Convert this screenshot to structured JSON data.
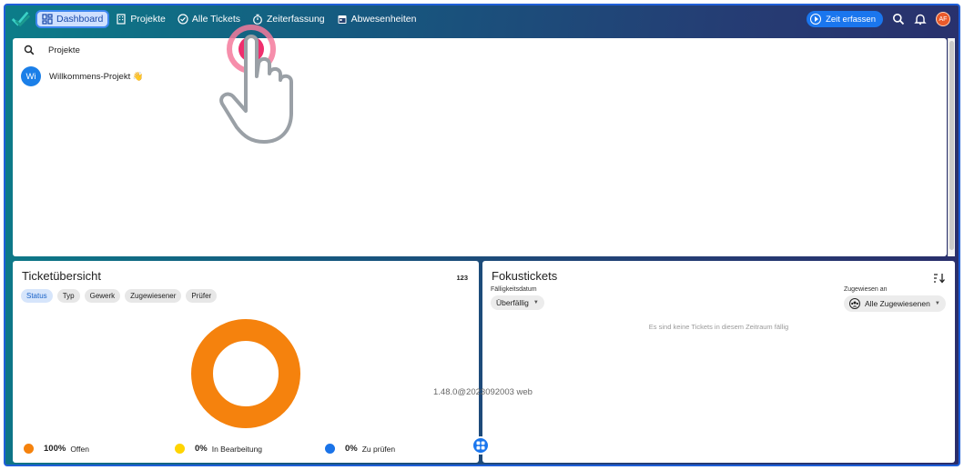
{
  "nav": {
    "items": [
      {
        "label": "Dashboard",
        "icon": "dashboard-icon",
        "active": true
      },
      {
        "label": "Projekte",
        "icon": "building-icon"
      },
      {
        "label": "Alle Tickets",
        "icon": "check-circle-icon"
      },
      {
        "label": "Zeiterfassung",
        "icon": "stopwatch-icon"
      },
      {
        "label": "Abwesenheiten",
        "icon": "calendar-icon"
      }
    ],
    "zeit_button": "Zeit erfassen",
    "avatar_initials": "AF"
  },
  "projects_panel": {
    "search_placeholder": "Projekte",
    "projects": [
      {
        "initials": "Wi",
        "name": "Willkommens-Projekt 👋"
      }
    ]
  },
  "ticket_overview": {
    "title": "Ticketübersicht",
    "number_toggle": "123",
    "tabs": [
      "Status",
      "Typ",
      "Gewerk",
      "Zugewiesener",
      "Prüfer"
    ],
    "active_tab": "Status",
    "legend": [
      {
        "pct": "100%",
        "label": "Offen",
        "color": "#f5820d"
      },
      {
        "pct": "0%",
        "label": "In Bearbeitung",
        "color": "#ffd400"
      },
      {
        "pct": "0%",
        "label": "Zu prüfen",
        "color": "#1a73e8"
      }
    ]
  },
  "chart_data": {
    "type": "pie",
    "categories": [
      "Offen",
      "In Bearbeitung",
      "Zu prüfen"
    ],
    "values": [
      100,
      0,
      0
    ]
  },
  "focus_tickets": {
    "title": "Fokustickets",
    "due_label": "Fälligkeitsdatum",
    "due_value": "Überfällig",
    "assigned_label": "Zugewiesen an",
    "assigned_value": "Alle Zugewiesenen",
    "empty_message": "Es sind keine Tickets in diesem Zeitraum fällig"
  },
  "version": "1.48.0@2023092003 web",
  "colors": {
    "accent": "#1a76ee",
    "offen": "#f5820d"
  }
}
